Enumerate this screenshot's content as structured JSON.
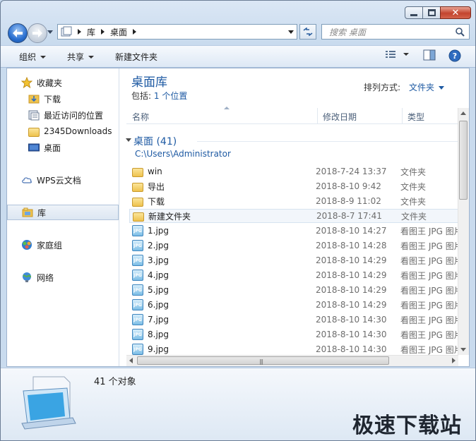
{
  "address": {
    "crumbs": [
      "库",
      "桌面"
    ]
  },
  "search": {
    "placeholder": "搜索 桌面"
  },
  "toolbar": {
    "organize": "组织",
    "share": "共享",
    "new_folder": "新建文件夹"
  },
  "sidebar": {
    "favorites": "收藏夹",
    "downloads": "下载",
    "recent": "最近访问的位置",
    "downloads2345": "2345Downloads",
    "desktop": "桌面",
    "wps": "WPS云文档",
    "libraries": "库",
    "homegroup": "家庭组",
    "network": "网络"
  },
  "library": {
    "title": "桌面库",
    "includes_label": "包括:",
    "includes_link": "1 个位置",
    "arrange_label": "排列方式:",
    "arrange_value": "文件夹"
  },
  "columns": {
    "name": "名称",
    "date": "修改日期",
    "type": "类型"
  },
  "group": {
    "title": "桌面 (41)",
    "path": "C:\\Users\\Administrator"
  },
  "files": [
    {
      "name": "win",
      "date": "2018-7-24 13:37",
      "type": "文件夹",
      "kind": "folder"
    },
    {
      "name": "导出",
      "date": "2018-8-10 9:42",
      "type": "文件夹",
      "kind": "folder"
    },
    {
      "name": "下载",
      "date": "2018-8-9 11:02",
      "type": "文件夹",
      "kind": "folder"
    },
    {
      "name": "新建文件夹",
      "date": "2018-8-7 17:41",
      "type": "文件夹",
      "kind": "folder"
    },
    {
      "name": "1.jpg",
      "date": "2018-8-10 14:27",
      "type": "看图王 JPG 图片",
      "kind": "jpg"
    },
    {
      "name": "2.jpg",
      "date": "2018-8-10 14:28",
      "type": "看图王 JPG 图片",
      "kind": "jpg"
    },
    {
      "name": "3.jpg",
      "date": "2018-8-10 14:29",
      "type": "看图王 JPG 图片",
      "kind": "jpg"
    },
    {
      "name": "4.jpg",
      "date": "2018-8-10 14:29",
      "type": "看图王 JPG 图片",
      "kind": "jpg"
    },
    {
      "name": "5.jpg",
      "date": "2018-8-10 14:29",
      "type": "看图王 JPG 图片",
      "kind": "jpg"
    },
    {
      "name": "6.jpg",
      "date": "2018-8-10 14:29",
      "type": "看图王 JPG 图片",
      "kind": "jpg"
    },
    {
      "name": "7.jpg",
      "date": "2018-8-10 14:30",
      "type": "看图王 JPG 图片",
      "kind": "jpg"
    },
    {
      "name": "8.jpg",
      "date": "2018-8-10 14:30",
      "type": "看图王 JPG 图片",
      "kind": "jpg"
    },
    {
      "name": "9.jpg",
      "date": "2018-8-10 14:30",
      "type": "看图王 JPG 图片",
      "kind": "jpg"
    }
  ],
  "details": {
    "count": "41 个对象"
  },
  "watermark": "极速下载站"
}
